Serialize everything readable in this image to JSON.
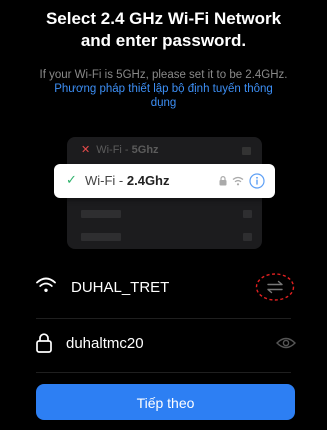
{
  "header": {
    "title_line1": "Select 2.4 GHz Wi-Fi Network",
    "title_line2": "and enter password.",
    "subtitle": "If your Wi-Fi is 5GHz, please set it to be 2.4GHz.",
    "router_link": "Phương pháp thiết lập bộ định tuyến thông dụng"
  },
  "illustration": {
    "row_5g": {
      "prefix": "Wi-Fi - ",
      "band": "5Ghz"
    },
    "row_24": {
      "prefix": "Wi-Fi - ",
      "band": "2.4Ghz"
    },
    "icons": [
      "close-icon",
      "check-icon",
      "lock-icon",
      "wifi-icon",
      "info-icon"
    ]
  },
  "network": {
    "ssid": "DUHAL_TRET"
  },
  "password": {
    "value": "duhaltmc20"
  },
  "buttons": {
    "next_label": "Tiếp theo"
  },
  "colors": {
    "accent": "#2d7ff3",
    "link": "#3d8ff5",
    "check": "#2fb36c",
    "cross": "#e64b4b",
    "switch_highlight": "#e02020"
  }
}
